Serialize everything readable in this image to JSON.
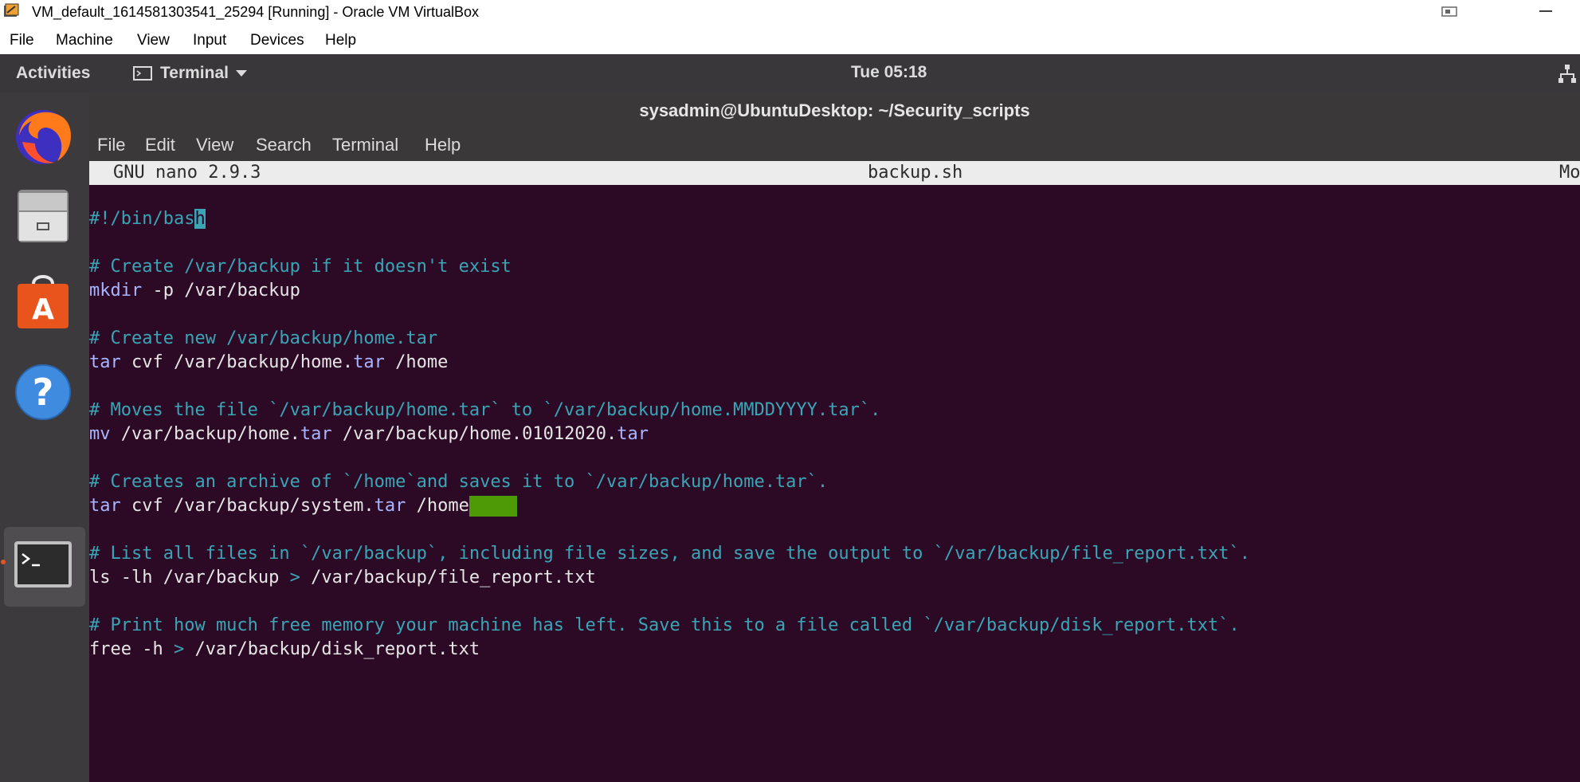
{
  "window": {
    "title": "VM_default_1614581303541_25294 [Running] - Oracle VM VirtualBox",
    "menu": [
      "File",
      "Machine",
      "View",
      "Input",
      "Devices",
      "Help"
    ]
  },
  "topbar": {
    "activities": "Activities",
    "app_name": "Terminal",
    "clock": "Tue 05:18"
  },
  "dock": {
    "items": [
      "firefox-icon",
      "files-icon",
      "software-center-icon",
      "help-icon",
      "terminal-icon"
    ]
  },
  "terminal": {
    "title": "sysadmin@UbuntuDesktop: ~/Security_scripts",
    "menu": [
      "File",
      "Edit",
      "View",
      "Search",
      "Terminal",
      "Help"
    ]
  },
  "nano": {
    "version": "GNU nano 2.9.3",
    "filename": "backup.sh",
    "status_right": "Mo",
    "lines": {
      "l1_shebang": "#!/bin/bas",
      "l1_cursor": "h",
      "l3_comment": "# Create /var/backup if it doesn't exist",
      "l4_cmd": "mkdir",
      "l4_args": " -p /var/backup",
      "l6_comment": "# Create new /var/backup/home.tar",
      "l7_cmd": "tar",
      "l7_a": " cvf /var/backup/home.",
      "l7_ext": "tar",
      "l7_b": " /home",
      "l9_comment": "# Moves the file `/var/backup/home.tar` to `/var/backup/home.MMDDYYYY.tar`.",
      "l10_cmd": "mv",
      "l10_a": " /var/backup/home.",
      "l10_ext1": "tar",
      "l10_b": " /var/backup/home.01012020.",
      "l10_ext2": "tar",
      "l12_comment": "# Creates an archive of `/home`and saves it to `/var/backup/home.tar`.",
      "l13_cmd": "tar",
      "l13_a": " cvf /var/backup/system.",
      "l13_ext": "tar",
      "l13_b": " /home",
      "l15_comment": "# List all files in `/var/backup`, including file sizes, and save the output to `/var/backup/file_report.txt`.",
      "l16_a": "ls -lh /var/backup ",
      "l16_gt": ">",
      "l16_b": " /var/backup/file_report.txt",
      "l18_comment": "# Print how much free memory your machine has left. Save this to a file called `/var/backup/disk_report.txt`.",
      "l19_a": "free -h ",
      "l19_gt": ">",
      "l19_b": " /var/backup/disk_report.txt"
    }
  }
}
